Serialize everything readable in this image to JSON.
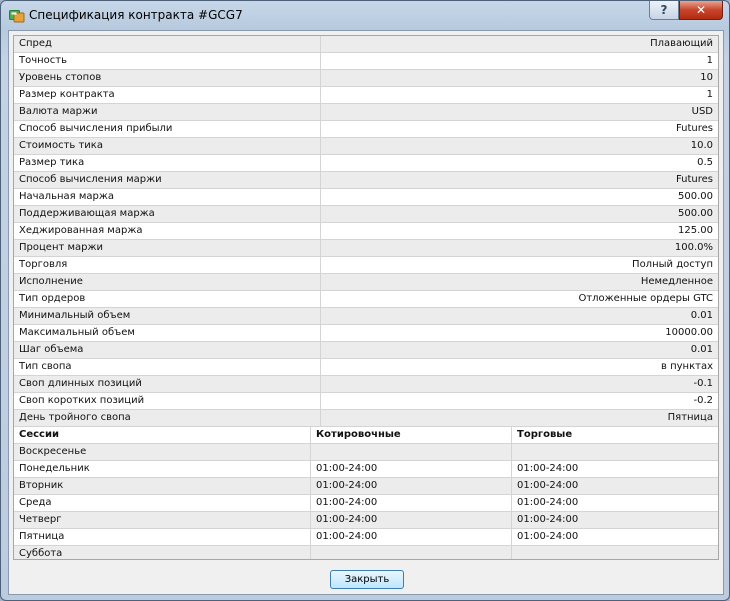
{
  "window": {
    "title": "Спецификация контракта #GCG7",
    "help_label": "?",
    "close_label": "✕"
  },
  "specs": [
    {
      "label": "Спред",
      "value": "Плавающий"
    },
    {
      "label": "Точность",
      "value": "1"
    },
    {
      "label": "Уровень стопов",
      "value": "10"
    },
    {
      "label": "Размер контракта",
      "value": "1"
    },
    {
      "label": "Валюта маржи",
      "value": "USD"
    },
    {
      "label": "Способ вычисления прибыли",
      "value": "Futures"
    },
    {
      "label": "Стоимость тика",
      "value": "10.0"
    },
    {
      "label": "Размер тика",
      "value": "0.5"
    },
    {
      "label": "Способ вычисления маржи",
      "value": "Futures"
    },
    {
      "label": "Начальная маржа",
      "value": "500.00"
    },
    {
      "label": "Поддерживающая маржа",
      "value": "500.00"
    },
    {
      "label": "Хеджированная маржа",
      "value": "125.00"
    },
    {
      "label": "Процент маржи",
      "value": "100.0%"
    },
    {
      "label": "Торговля",
      "value": "Полный доступ"
    },
    {
      "label": "Исполнение",
      "value": "Немедленное"
    },
    {
      "label": "Тип ордеров",
      "value": "Отложенные ордеры GTC"
    },
    {
      "label": "Минимальный объем",
      "value": "0.01"
    },
    {
      "label": "Максимальный объем",
      "value": "10000.00"
    },
    {
      "label": "Шаг объема",
      "value": "0.01"
    },
    {
      "label": "Тип свопа",
      "value": "в пунктах"
    },
    {
      "label": "Своп длинных позиций",
      "value": "-0.1"
    },
    {
      "label": "Своп коротких позиций",
      "value": "-0.2"
    },
    {
      "label": "День тройного свопа",
      "value": "Пятница"
    }
  ],
  "sessions": {
    "headers": [
      "Сессии",
      "Котировочные",
      "Торговые"
    ],
    "rows": [
      {
        "day": "Воскресенье",
        "quote": "",
        "trade": ""
      },
      {
        "day": "Понедельник",
        "quote": "01:00-24:00",
        "trade": "01:00-24:00"
      },
      {
        "day": "Вторник",
        "quote": "01:00-24:00",
        "trade": "01:00-24:00"
      },
      {
        "day": "Среда",
        "quote": "01:00-24:00",
        "trade": "01:00-24:00"
      },
      {
        "day": "Четверг",
        "quote": "01:00-24:00",
        "trade": "01:00-24:00"
      },
      {
        "day": "Пятница",
        "quote": "01:00-24:00",
        "trade": "01:00-24:00"
      },
      {
        "day": "Суббота",
        "quote": "",
        "trade": ""
      }
    ]
  },
  "footer": {
    "close_button": "Закрыть"
  }
}
